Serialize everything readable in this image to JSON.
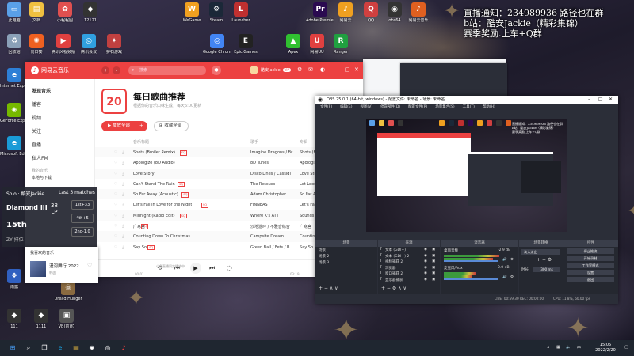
{
  "overlay_text": {
    "line1": "直播通知：234989936 路径也在群",
    "line2": "b站：酷安Jackie（精彩集锦）",
    "line3": "赛季奖励.上车+Q群"
  },
  "desktop_icons": [
    {
      "label": "此电脑",
      "color": "#5aa0e8",
      "glyph": "▭"
    },
    {
      "label": "文档",
      "color": "#f0c040",
      "glyph": "▤"
    },
    {
      "label": "小程程图",
      "color": "#e05050",
      "glyph": "✿"
    },
    {
      "label": "12121",
      "color": "#333",
      "glyph": "◆"
    },
    {
      "label": "回收站",
      "color": "#8aa0b8",
      "glyph": "♻"
    },
    {
      "label": "向日葵",
      "color": "#f06020",
      "glyph": "✺"
    },
    {
      "label": "腾讯风视频播",
      "color": "#e04040",
      "glyph": "▶"
    },
    {
      "label": "腾讯会议",
      "color": "#30a0e0",
      "glyph": "◎"
    },
    {
      "label": "护石游戏",
      "color": "#c04040",
      "glyph": "✦"
    },
    {
      "label": "Internet Explorer",
      "color": "#2d7fd6",
      "glyph": "e"
    },
    {
      "label": "GeForce Experience",
      "color": "#76b900",
      "glyph": "◈"
    },
    {
      "label": "Microsoft Edge",
      "color": "#1a9bd7",
      "glyph": "e"
    },
    {
      "label": "Dread Hunger",
      "color": "#8a6a40",
      "glyph": "☠"
    },
    {
      "label": "111",
      "color": "#333",
      "glyph": "◆"
    },
    {
      "label": "1111",
      "color": "#333",
      "glyph": "◆"
    },
    {
      "label": "VB(前)位",
      "color": "#555",
      "glyph": "▣"
    },
    {
      "label": "雨露",
      "color": "#3060c0",
      "glyph": "❖"
    },
    {
      "label": "WeGame",
      "color": "#f0a020",
      "glyph": "W"
    },
    {
      "label": "Steam",
      "color": "#1b2838",
      "glyph": "⚙"
    },
    {
      "label": "Launcher",
      "color": "#c03030",
      "glyph": "L"
    },
    {
      "label": "Adobe Premiere",
      "color": "#2a0a50",
      "glyph": "Pr"
    },
    {
      "label": "网易云",
      "color": "#f0a020",
      "glyph": "♪"
    },
    {
      "label": "QQ",
      "color": "#d04040",
      "glyph": "Q"
    },
    {
      "label": "obs64",
      "color": "#333",
      "glyph": "◉"
    },
    {
      "label": "网易云音乐",
      "color": "#e06020",
      "glyph": "♪"
    },
    {
      "label": "Google Chrome",
      "color": "#4285f4",
      "glyph": "◎"
    },
    {
      "label": "Epic Games",
      "color": "#222",
      "glyph": "E"
    },
    {
      "label": "Apex",
      "color": "#30c030",
      "glyph": "▲"
    },
    {
      "label": "网易UU",
      "color": "#e04040",
      "glyph": "U"
    },
    {
      "label": "Ranger",
      "color": "#20a040",
      "glyph": "R"
    }
  ],
  "netease": {
    "app_name": "网易云音乐",
    "search_placeholder": "搜索",
    "user_name": "酷安Jackie",
    "vip": "VIP",
    "sidebar": {
      "items": [
        "发现音乐",
        "播客",
        "视频",
        "关注",
        "直播",
        "私人FM"
      ],
      "section": "我的音乐",
      "sub_items": [
        "本地与下载",
        "我喜欢的音乐"
      ]
    },
    "calendar_day": "20",
    "page_title": "每日歌曲推荐",
    "page_subtitle": "根据你的音乐口味生成，每天6:00更新",
    "play_all": "播放全部",
    "collect_all": "收藏全部",
    "table_headers": [
      "音乐标题",
      "歌手",
      "专辑"
    ],
    "songs": [
      {
        "title": "Shots (Broiler Remix)",
        "tag": "SQ",
        "artist": "Imagine Dragons / Br...",
        "album": "Shots (Broiler Remix)"
      },
      {
        "title": "Apologize (8D Audio)",
        "tag": "",
        "artist": "8D Tunes",
        "album": "Apologize (8D Audio)"
      },
      {
        "title": "Love Story",
        "tag": "",
        "artist": "Disco Lines / Cassidi",
        "album": "Love Story"
      },
      {
        "title": "Can't Stand The Rain",
        "tag": "SQ",
        "artist": "The Rescues",
        "album": "Let Loose The Horses"
      },
      {
        "title": "So Far Away (Acoustic)",
        "tag": "SQ",
        "artist": "Adam Christopher",
        "album": "So Far Away (Acoustic)"
      },
      {
        "title": "Let's Fall in Love for the Night",
        "tag": "SQ",
        "artist": "FINNEAS",
        "album": "Let's Fall in Love for"
      },
      {
        "title": "Midnight (Radio Edit)",
        "tag": "SQ",
        "artist": "Where K's ATT",
        "album": "Sounds Of The Stree..."
      },
      {
        "title": "广寒宫",
        "tag": "SQ",
        "artist": "沙地游吟 / 不雅音综合",
        "album": "广寒宫"
      },
      {
        "title": "Counting Down To Christmas",
        "tag": "",
        "artist": "Campsite Dream",
        "album": "Counting Down To Chri..."
      },
      {
        "title": "Say So",
        "tag": "SQ",
        "artist": "Green Ball / Fets / B...",
        "album": "Say So"
      }
    ],
    "player": {
      "time_current": "00:01",
      "time_total": "03:19",
      "lyric_btn": "词",
      "bottom_hint": "小鱼直播同步播放中"
    }
  },
  "rank_overlay": {
    "header": "Solo · 酷安Jackie",
    "last_matches": "Last 3 matches",
    "tier": "Diamond III",
    "lp_value": "38",
    "lp_label": "LP",
    "position": "15th",
    "badges": [
      "1st+33",
      "4th+5",
      "2nd-1.0"
    ],
    "footer": "ZY·排位"
  },
  "mini_popup": {
    "header": "我喜欢的音乐",
    "title": "漫河舞行 2022",
    "artist": "韩国"
  },
  "obs": {
    "title": "OBS 25.0.1 (64-bit, windows) - 配置文件: 未命名 - 场景: 未命名",
    "menu": [
      "文件(F)",
      "编辑(E)",
      "视图(V)",
      "停靠部件(D)",
      "配置文件(P)",
      "场景集合(S)",
      "工具(T)",
      "帮助(H)"
    ],
    "docks": {
      "scenes_header": "场景",
      "scenes": [
        "场景",
        "场景 2",
        "场景 3"
      ],
      "sources_header": "来源",
      "sources": [
        "文本 (GDI+)",
        "文本 (GDI+) 2",
        "视频捕获 2",
        "浏览器",
        "窗口捕获 2",
        "显示器捕获"
      ],
      "mixer_header": "混音器",
      "mixer_tracks": [
        {
          "name": "桌面音频",
          "db": "-2.9 dB"
        },
        {
          "name": "麦克风/Aux",
          "db": "0.0 dB"
        }
      ],
      "transitions_header": "场景转换",
      "transition_name": "淡入淡出",
      "duration_label": "时长",
      "duration_value": "300 ms",
      "controls_header": "控件",
      "controls": [
        "停止推流",
        "开始录制",
        "工作室模式",
        "设置",
        "退出"
      ]
    },
    "status": {
      "live": "LIVE: 00:59:30",
      "rec": "REC: 00:00:00",
      "cpu": "CPU: 11.8%, 60.00 fps"
    }
  },
  "taskbar": {
    "time": "15:05",
    "date": "2022/2/20",
    "tray_lang": "中"
  }
}
